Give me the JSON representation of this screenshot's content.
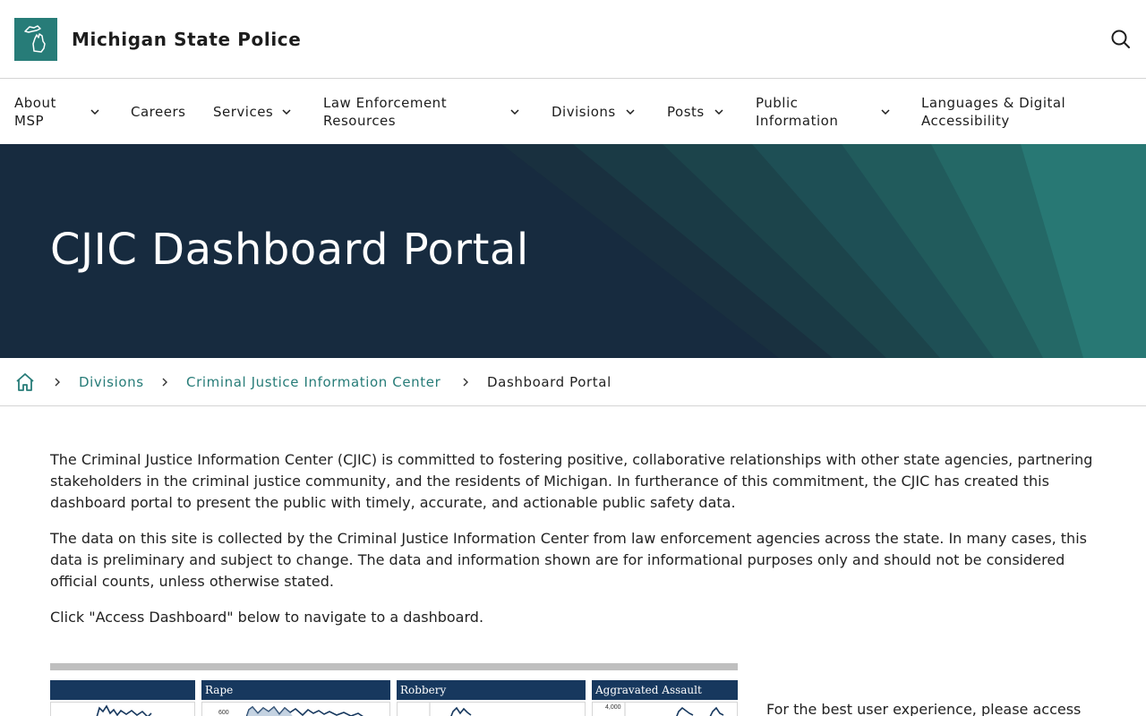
{
  "header": {
    "site_title": "Michigan State Police",
    "logo_icon": "michigan-map-icon",
    "search_icon": "search-icon",
    "brand_color": "#277c78"
  },
  "nav": {
    "items": [
      {
        "label_line1": "About",
        "label_line2": "MSP",
        "has_dropdown": true
      },
      {
        "label_line1": "Careers",
        "label_line2": "",
        "has_dropdown": false
      },
      {
        "label_line1": "Services",
        "label_line2": "",
        "has_dropdown": true
      },
      {
        "label_line1": "Law Enforcement",
        "label_line2": "Resources",
        "has_dropdown": true
      },
      {
        "label_line1": "Divisions",
        "label_line2": "",
        "has_dropdown": true
      },
      {
        "label_line1": "Posts",
        "label_line2": "",
        "has_dropdown": true
      },
      {
        "label_line1": "Public",
        "label_line2": "Information",
        "has_dropdown": true
      },
      {
        "label_line1": "Languages & Digital",
        "label_line2": "Accessibility",
        "has_dropdown": false
      }
    ]
  },
  "hero": {
    "title": "CJIC Dashboard Portal",
    "bg_color": "#172b3f"
  },
  "breadcrumb": {
    "home_icon": "home-icon",
    "links": [
      "Divisions",
      "Criminal Justice Information Center"
    ],
    "current": "Dashboard Portal"
  },
  "content": {
    "paragraphs": [
      "The Criminal Justice Information Center (CJIC) is committed to fostering positive, collaborative relationships with other state agencies, partnering stakeholders in the criminal justice community, and the residents of Michigan.  In furtherance of this commitment, the CJIC has created this dashboard portal to present the public with timely, accurate, and actionable public safety data.",
      "The data on this site is collected by the Criminal Justice Information Center from law enforcement agencies across the state.  In many cases, this data is preliminary and subject to change.  The data and information shown are for informational purposes only and should not be considered official counts, unless otherwise stated.",
      "Click \"Access Dashboard\" below to navigate to a dashboard."
    ]
  },
  "preview": {
    "panels": [
      {
        "title": "",
        "tick": ""
      },
      {
        "title": "Rape",
        "tick": "600"
      },
      {
        "title": "Robbery",
        "tick": ""
      },
      {
        "title": "Aggravated Assault",
        "tick": "4,000"
      }
    ]
  },
  "side_note": "For the best user experience, please access"
}
